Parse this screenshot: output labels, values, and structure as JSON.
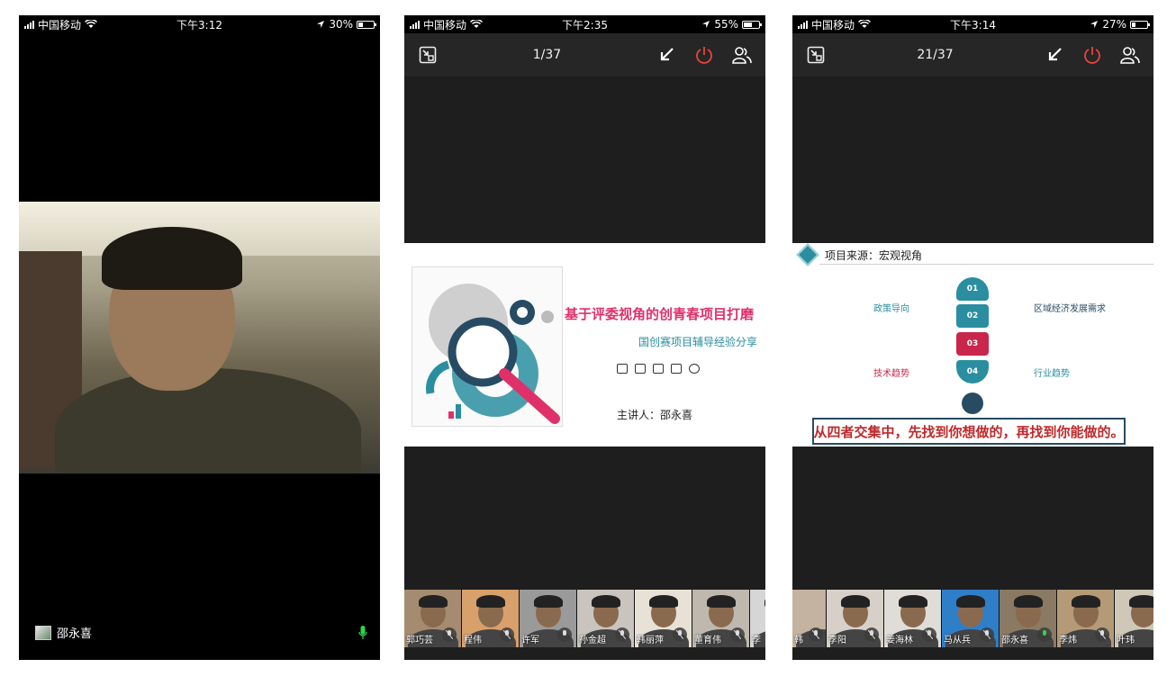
{
  "phones": [
    {
      "status": {
        "carrier": "中国移动",
        "time": "下午3:12",
        "battery": "30%",
        "battery_level": 0.3
      },
      "speaker": {
        "name": "邵永喜"
      }
    },
    {
      "status": {
        "carrier": "中国移动",
        "time": "下午2:35",
        "battery": "55%",
        "battery_level": 0.55
      },
      "toolbar": {
        "page": "1/37"
      },
      "slide": {
        "title": "基于评委视角的创青春项目打磨",
        "subtitle": "国创赛项目辅导经验分享",
        "presenter": "主讲人：邵永喜"
      },
      "participants": [
        "郭巧芸",
        "程伟",
        "许军",
        "孙金超",
        "韩丽萍",
        "董育伟",
        "李"
      ]
    },
    {
      "status": {
        "carrier": "中国移动",
        "time": "下午3:14",
        "battery": "27%",
        "battery_level": 0.27
      },
      "toolbar": {
        "page": "21/37"
      },
      "slide": {
        "heading": "项目来源：宏观视角",
        "pills": [
          "01",
          "02",
          "03",
          "04"
        ],
        "labels": {
          "policy": "政策导向",
          "regional": "区域经济发展需求",
          "tech": "技术趋势",
          "industry": "行业趋势"
        },
        "conclusion": "从四者交集中，先找到你想做的，再找到你能做的。"
      },
      "participants": [
        "韩",
        "李阳",
        "姜海林",
        "马从兵",
        "邵永喜",
        "李炜",
        "叶玮"
      ]
    }
  ],
  "colors": {
    "teal": "#2a8ea0",
    "red": "#c8264a",
    "navy": "#274b63",
    "power": "#e8453c",
    "mic_active": "#2fd34a"
  },
  "icons": [
    "signal-icon",
    "wifi-icon",
    "location-icon",
    "battery-icon",
    "exit-fullscreen-icon",
    "minimize-arrow-icon",
    "power-icon",
    "participants-icon",
    "mic-icon",
    "mic-muted-icon"
  ]
}
